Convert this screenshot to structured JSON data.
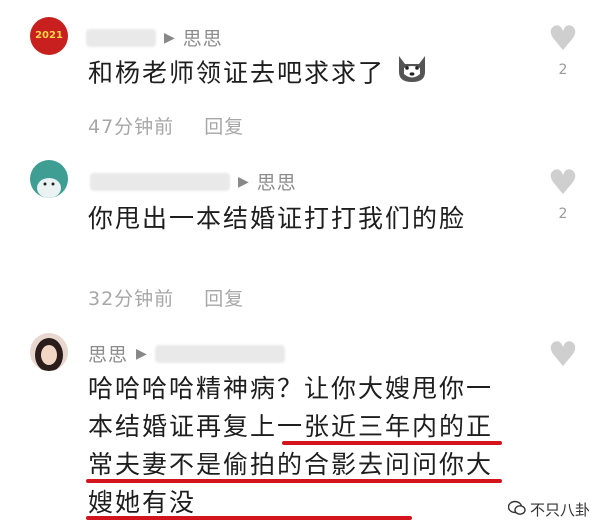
{
  "comments": [
    {
      "reply_to": "思思",
      "text": "和杨老师领证去吧求求了",
      "time": "47分钟前",
      "reply_label": "回复",
      "likes": "2",
      "avatar_text": "2021"
    },
    {
      "reply_to": "思思",
      "text": "你甩出一本结婚证打打我们的脸",
      "time": "32分钟前",
      "reply_label": "回复",
      "likes": "2"
    },
    {
      "author": "思思",
      "text": "哈哈哈哈精神病？让你大嫂甩你一本结婚证再复上一张近三年内的正常夫妻不是偷拍的合影去问问你大嫂她有没",
      "likes": ""
    }
  ],
  "watermark": {
    "text": "不只八卦"
  },
  "colors": {
    "underline": "#d4141c",
    "heart": "#cfcfcf"
  },
  "icons": {
    "like": "heart-icon",
    "emoji": "husky-emoji-icon",
    "wechat": "wechat-icon"
  }
}
